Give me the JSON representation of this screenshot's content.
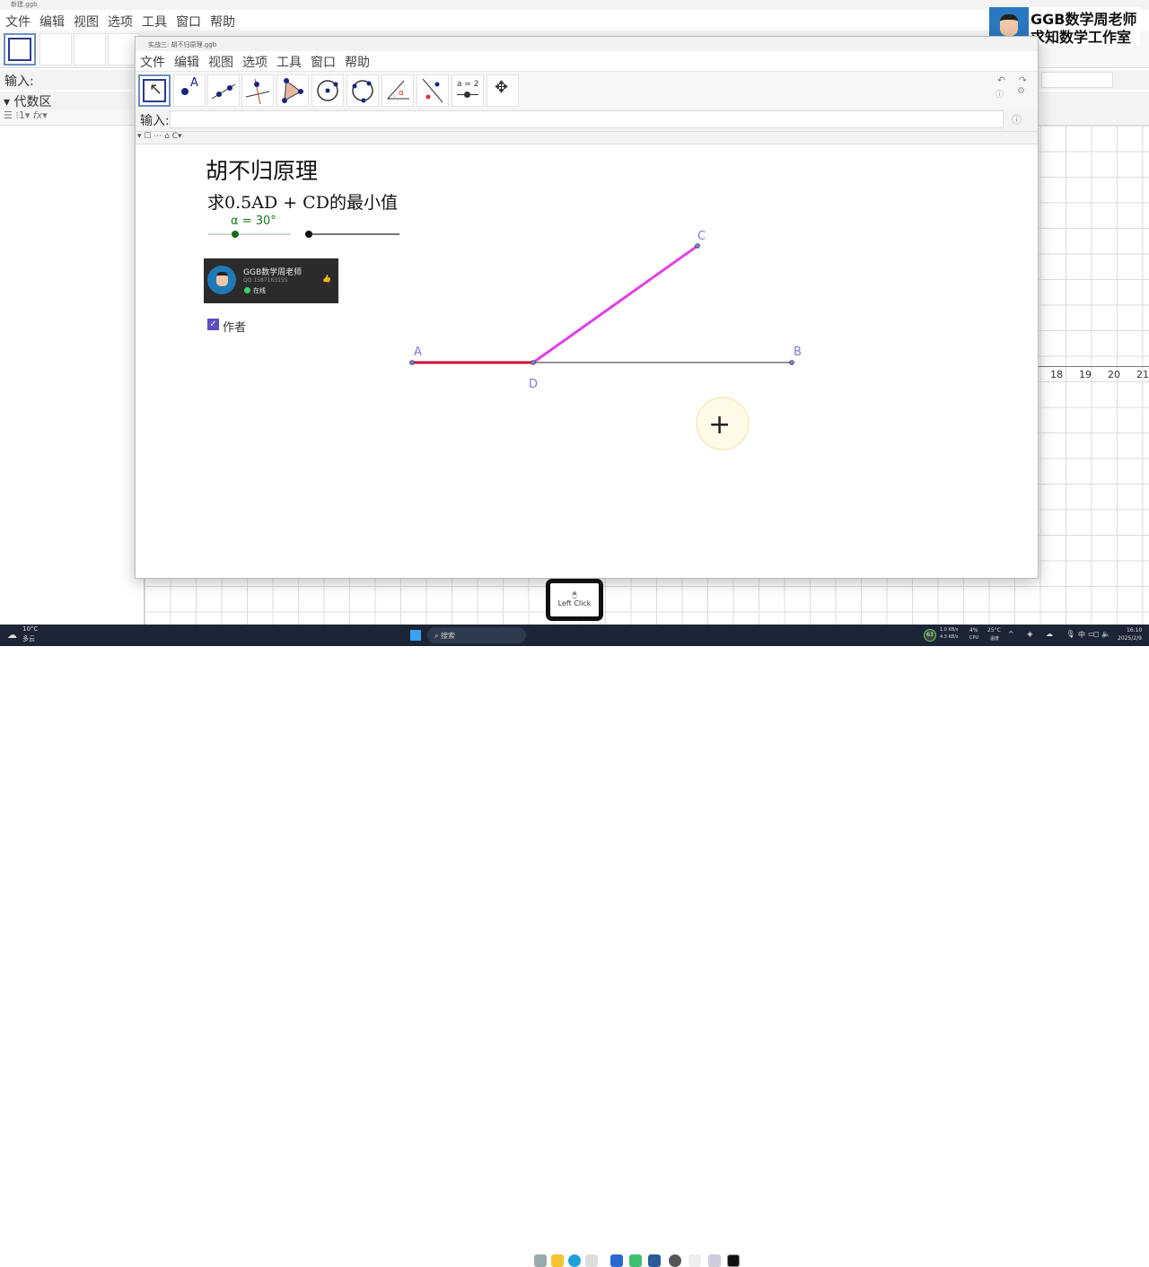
{
  "bg_window": {
    "title": "新建.ggb",
    "menu": [
      "文件",
      "编辑",
      "视图",
      "选项",
      "工具",
      "窗口",
      "帮助"
    ],
    "input_label": "输入:",
    "algebra_label": "代数区",
    "axis_ticks": [
      "18",
      "19",
      "20",
      "21"
    ]
  },
  "watermark": {
    "line1": "GGB数学周老师",
    "line2": "求知数学工作室"
  },
  "fg_window": {
    "title": "实战三: 胡不归原理.ggb",
    "menu": [
      "文件",
      "编辑",
      "视图",
      "选项",
      "工具",
      "窗口",
      "帮助"
    ],
    "input_label": "输入:",
    "tools": [
      "move",
      "point",
      "line",
      "perpendicular",
      "polygon",
      "circle",
      "circle-3pts",
      "angle",
      "reflect",
      "slider",
      "move-view"
    ],
    "slider_tool_label": "a = 2"
  },
  "canvas": {
    "title": "胡不归原理",
    "subtitle": "求0.5AD + CD的最小值",
    "slider_label": "α = 30°",
    "alpha_value": 30,
    "card": {
      "name": "GGB数学周老师",
      "qq": "QQ 1587163155",
      "status": "在线"
    },
    "checkbox_label": "作者",
    "checkbox_checked": true,
    "points": {
      "A": "A",
      "B": "B",
      "C": "C",
      "D": "D"
    },
    "colors": {
      "AD": "#d0103a",
      "DC": "#e040e8",
      "DB": "#555555"
    }
  },
  "click_overlay": {
    "label": "Left Click"
  },
  "taskbar": {
    "weather_temp": "10°C",
    "weather_desc": "多云",
    "search": "搜索",
    "net_up": "1.0 KB/s",
    "net_down": "4.3 KB/s",
    "battery": "63",
    "cpu": "4%",
    "cpu_label": "CPU",
    "temp": "25°C",
    "temp_label": "温度",
    "ime": "中",
    "time": "16:10",
    "date": "2025/2/9"
  }
}
